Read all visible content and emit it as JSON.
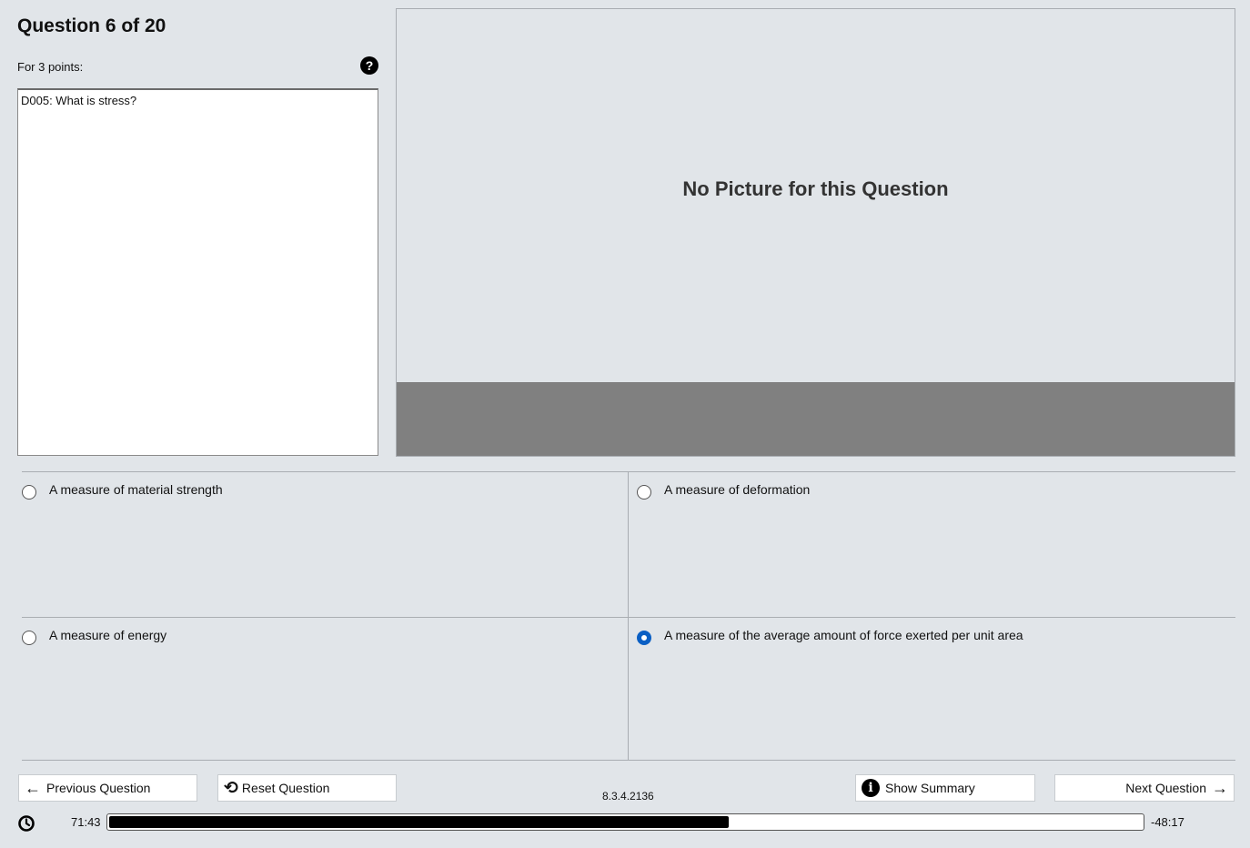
{
  "question": {
    "title": "Question 6 of 20",
    "points": "For 3 points:",
    "text": "D005: What is stress?"
  },
  "picture": {
    "message": "No Picture for this Question"
  },
  "options": [
    {
      "label": "A measure of material strength",
      "selected": false
    },
    {
      "label": "A measure of deformation",
      "selected": false
    },
    {
      "label": "A measure of energy",
      "selected": false
    },
    {
      "label": "A measure of the average amount of force exerted per unit area",
      "selected": true
    }
  ],
  "buttons": {
    "previous": "Previous Question",
    "reset": "Reset Question",
    "summary": "Show Summary",
    "next": "Next Question"
  },
  "version": "8.3.4.2136",
  "timer": {
    "elapsed": "71:43",
    "remaining": "-48:17",
    "progress_fraction": 0.6
  },
  "colors": {
    "background": "#e1e5e9",
    "selected_radio": "#0a5fc4",
    "picture_bar": "#808080"
  }
}
